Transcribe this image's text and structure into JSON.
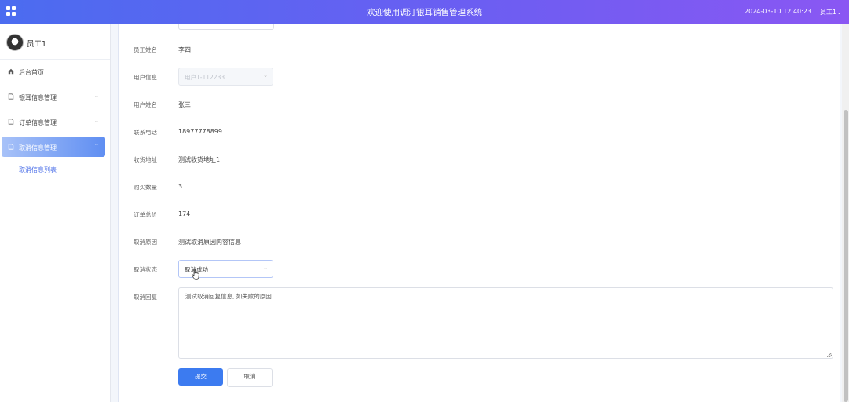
{
  "header": {
    "title": "欢迎使用调汀银耳销售管理系统",
    "datetime": "2024-03-10 12:40:23",
    "user": "员工1"
  },
  "sidebar": {
    "profile_name": "员工1",
    "items": [
      {
        "label": "后台首页"
      },
      {
        "label": "银耳信息管理"
      },
      {
        "label": "订单信息管理"
      },
      {
        "label": "取消信息管理"
      }
    ],
    "sub_item": "取消信息列表"
  },
  "form": {
    "fields": [
      {
        "label": "员工姓名",
        "value": "李四"
      },
      {
        "label": "用户信息",
        "value": "用户1-112233"
      },
      {
        "label": "用户姓名",
        "value": "张三"
      },
      {
        "label": "联系电话",
        "value": "18977778899"
      },
      {
        "label": "收货地址",
        "value": "测试收货地址1"
      },
      {
        "label": "购买数量",
        "value": "3"
      },
      {
        "label": "订单总价",
        "value": "174"
      },
      {
        "label": "取消原因",
        "value": "测试取消原因内容信息"
      },
      {
        "label": "取消状态",
        "value": "取消成功"
      },
      {
        "label": "取消回复",
        "value": "测试取消回复信息, 如失败的原因"
      }
    ],
    "submit_label": "提交",
    "cancel_label": "取消"
  },
  "icons": {
    "grid": "grid-icon",
    "home": "home-icon",
    "doc": "document-icon"
  },
  "colors": {
    "header_start": "#4b6cf0",
    "header_end": "#8a57f3",
    "primary": "#3c7bf0",
    "link": "#4a6ee8"
  }
}
